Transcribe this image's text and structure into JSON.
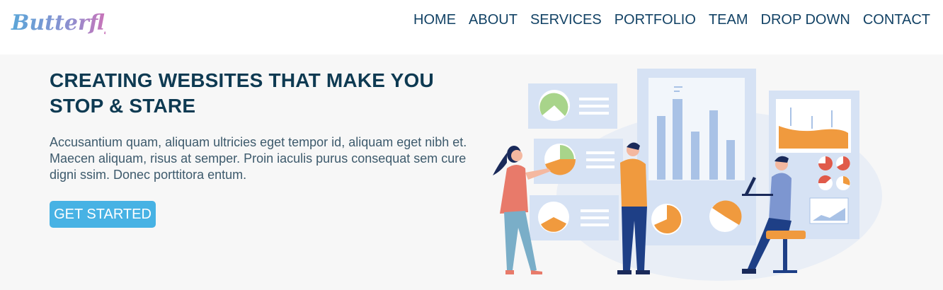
{
  "brand": {
    "logo_text": "Butterfly"
  },
  "nav": {
    "items": [
      "HOME",
      "ABOUT",
      "SERVICES",
      "PORTFOLIO",
      "TEAM",
      "DROP DOWN",
      "CONTACT"
    ]
  },
  "hero": {
    "title_line1": "CREATING WEBSITES THAT MAKE YOU",
    "title_line2": "STOP & STARE",
    "description": "Accusantium quam, aliquam ultricies eget tempor id, aliquam eget nibh et. Maecen aliquam, risus at semper. Proin iaculis purus consequat sem cure digni ssim. Donec porttitora entum.",
    "cta_label": "GET STARTED"
  },
  "colors": {
    "accent": "#47b2e4",
    "nav_text": "#124265",
    "title": "#0e3a52",
    "body_text": "#3d5a6c",
    "illustration_orange": "#f09a3e",
    "illustration_blue": "#a9c2e6"
  }
}
